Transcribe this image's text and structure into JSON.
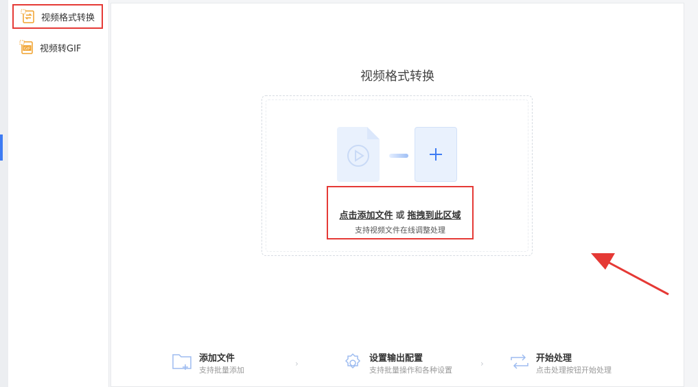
{
  "sidebar": {
    "items": [
      {
        "label": "视频格式转换",
        "icon": "video-convert-icon",
        "active": true
      },
      {
        "label": "视频转GIF",
        "icon": "gif-icon",
        "active": false
      }
    ]
  },
  "main": {
    "title": "视频格式转换",
    "drop_zone": {
      "click_text": "点击添加文件",
      "or_text": "或",
      "drag_text": "拖拽到此区域",
      "subtitle": "支持视频文件在线调整处理"
    },
    "steps": [
      {
        "title": "添加文件",
        "desc": "支持批量添加",
        "icon": "add-folder-icon"
      },
      {
        "title": "设置输出配置",
        "desc": "支持批量操作和各种设置",
        "icon": "settings-gear-icon"
      },
      {
        "title": "开始处理",
        "desc": "点击处理按钮开始处理",
        "icon": "process-cycle-icon"
      }
    ],
    "step_separator": "›"
  },
  "colors": {
    "accent": "#3d7bf3",
    "highlight": "#e53935",
    "icon_orange": "#f0a02a"
  }
}
